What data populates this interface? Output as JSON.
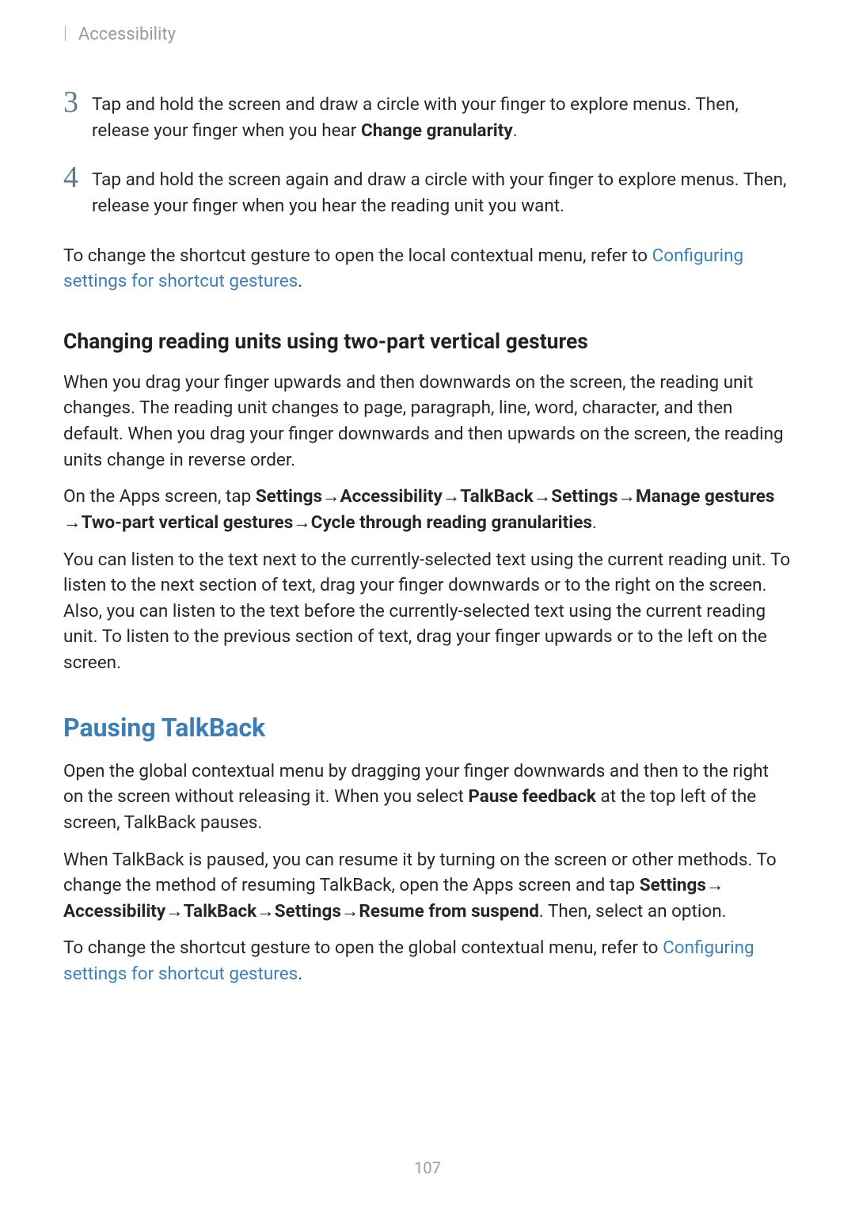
{
  "header": {
    "section": "Accessibility",
    "sep": "|"
  },
  "step3": {
    "num": "3",
    "t1": "Tap and hold the screen and draw a circle with your finger to explore menus. Then, release your finger when you hear ",
    "b1": "Change granularity",
    "t2": "."
  },
  "step4": {
    "num": "4",
    "t1": "Tap and hold the screen again and draw a circle with your finger to explore menus. Then, release your finger when you hear the reading unit you want."
  },
  "p1": {
    "t1": "To change the shortcut gesture to open the local contextual menu, refer to ",
    "link": "Configuring settings for shortcut gestures",
    "t2": "."
  },
  "h3a": "Changing reading units using two-part vertical gestures",
  "p2": "When you drag your finger upwards and then downwards on the screen, the reading unit changes. The reading unit changes to page, paragraph, line, word, character, and then default. When you drag your finger downwards and then upwards on the screen, the reading units change in reverse order.",
  "p3": {
    "t1": "On the Apps screen, tap ",
    "b1": "Settings",
    "arr": " → ",
    "b2": "Accessibility",
    "b3": "TalkBack",
    "b4": "Settings",
    "b5": "Manage gestures",
    "b6": "Two-part vertical gestures",
    "b7": "Cycle through reading granularities",
    "t2": "."
  },
  "p4": "You can listen to the text next to the currently-selected text using the current reading unit. To listen to the next section of text, drag your finger downwards or to the right on the screen. Also, you can listen to the text before the currently-selected text using the current reading unit. To listen to the previous section of text, drag your finger upwards or to the left on the screen.",
  "h2a": "Pausing TalkBack",
  "p5": {
    "t1": "Open the global contextual menu by dragging your finger downwards and then to the right on the screen without releasing it. When you select ",
    "b1": "Pause feedback",
    "t2": " at the top left of the screen, TalkBack pauses."
  },
  "p6": {
    "t1": "When TalkBack is paused, you can resume it by turning on the screen or other methods. To change the method of resuming TalkBack, open the Apps screen and tap ",
    "b1": "Settings",
    "arr": " → ",
    "b2": "Accessibility",
    "b3": "TalkBack",
    "b4": "Settings",
    "b5": "Resume from suspend",
    "t2": ". Then, select an option."
  },
  "p7": {
    "t1": "To change the shortcut gesture to open the global contextual menu, refer to ",
    "link": "Configuring settings for shortcut gestures",
    "t2": "."
  },
  "pagenum": "107"
}
